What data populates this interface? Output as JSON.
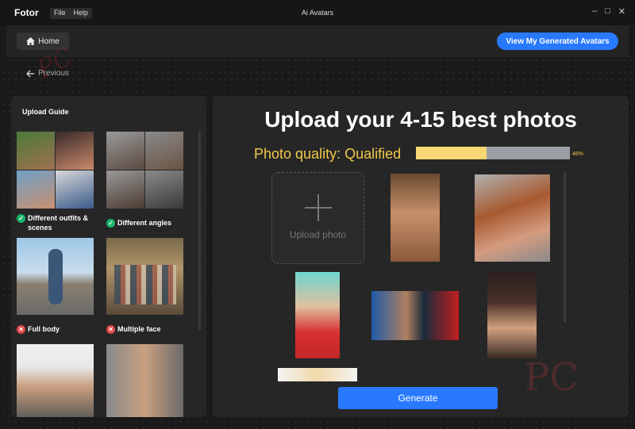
{
  "app": {
    "name": "Fotor",
    "menu": [
      "File",
      "Help"
    ],
    "window_title": "Ai Avatars"
  },
  "toolbar": {
    "home_label": "Home",
    "view_label": "View My Generated Avatars"
  },
  "nav": {
    "previous_label": "Previous"
  },
  "guide": {
    "title": "Upload Guide",
    "items": [
      {
        "label": "Different outfits & scenes",
        "status": "ok"
      },
      {
        "label": "Different angles",
        "status": "ok"
      },
      {
        "label": "Full body",
        "status": "bad"
      },
      {
        "label": "Multiple face",
        "status": "bad"
      }
    ]
  },
  "main": {
    "heading": "Upload your 4-15 best photos",
    "quality_label": "Photo quality: Qualified",
    "quality_percent": 46,
    "quality_text": "46%",
    "upload_label": "Upload photo",
    "generate_label": "Generate"
  },
  "colors": {
    "accent": "#2979ff",
    "quality": "#f2c94c",
    "ok": "#18b46b",
    "bad": "#e04848"
  }
}
